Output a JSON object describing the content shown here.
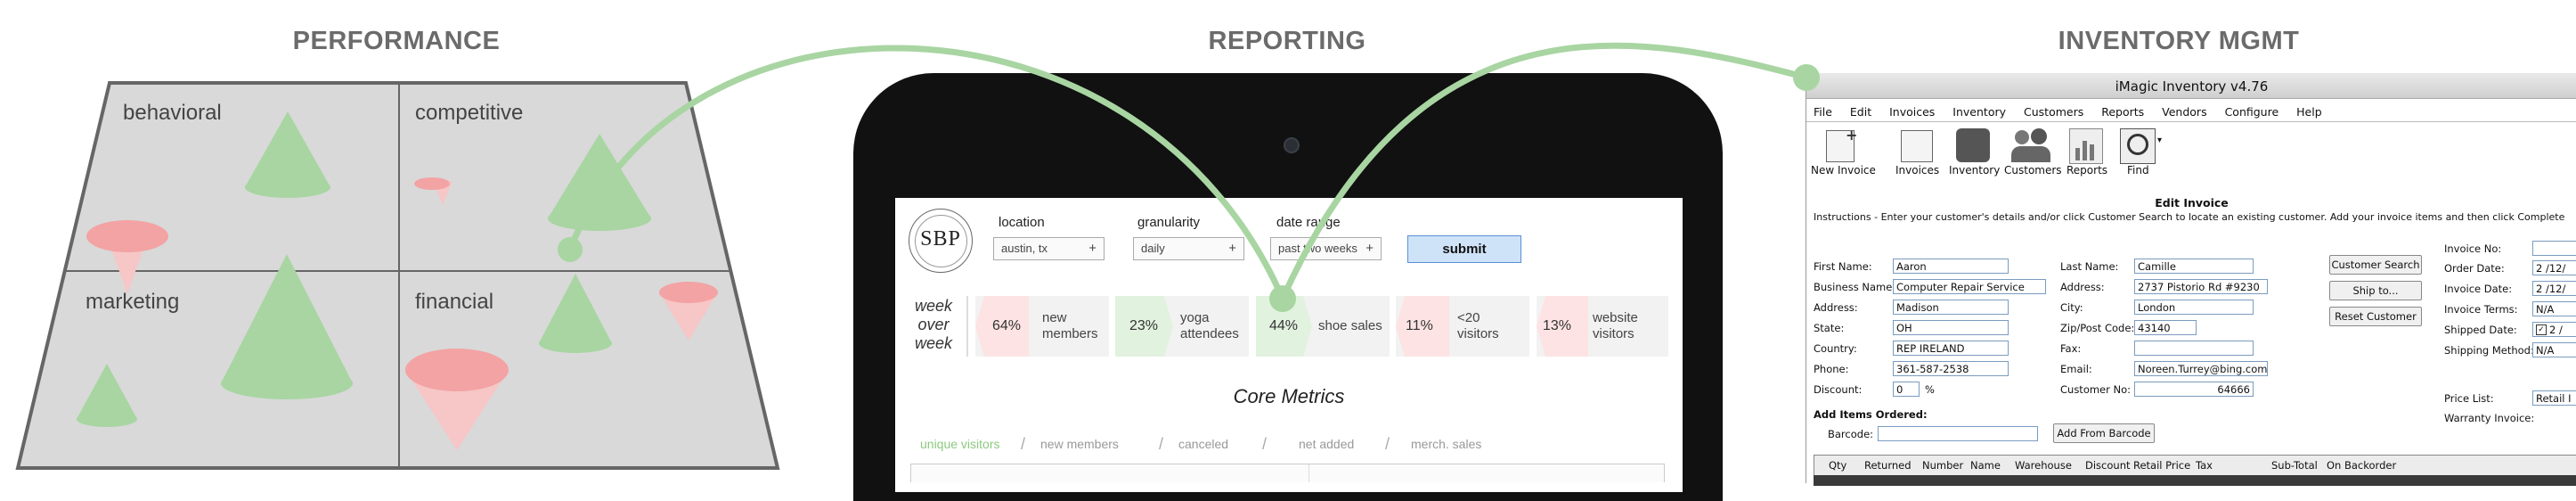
{
  "titles": {
    "performance": "PERFORMANCE",
    "reporting": "REPORTING",
    "inventory": "INVENTORY MGMT"
  },
  "performance": {
    "quadrants": [
      "behavioral",
      "competitive",
      "marketing",
      "financial"
    ],
    "colors": {
      "green": "#a8d5a2",
      "red": "#f3a3a3",
      "bg": "#d9d9d9"
    }
  },
  "reporting": {
    "logo_letters": "SBP",
    "logo_ring": "SEATTLE BOULDERING PROJECT",
    "filters": [
      {
        "label": "location",
        "value": "austin, tx"
      },
      {
        "label": "granularity",
        "value": "daily"
      },
      {
        "label": "date range",
        "value": "past two weeks"
      }
    ],
    "submit_label": "submit",
    "wow_label": [
      "week",
      "over",
      "week"
    ],
    "kpis": [
      {
        "value": "64%",
        "label": [
          "new",
          "members"
        ],
        "trend": "down"
      },
      {
        "value": "23%",
        "label": [
          "yoga",
          "attendees"
        ],
        "trend": "up"
      },
      {
        "value": "44%",
        "label": [
          "shoe sales"
        ],
        "trend": "up"
      },
      {
        "value": "11%",
        "label": [
          "<20",
          "visitors"
        ],
        "trend": "down"
      },
      {
        "value": "13%",
        "label": [
          "website",
          "visitors"
        ],
        "trend": "down"
      }
    ],
    "section_title": "Core Metrics",
    "tabs": [
      "unique visitors",
      "new members",
      "canceled",
      "net added",
      "merch. sales"
    ],
    "tab_colors": {
      "active": "#8cc97f",
      "inactive": "#999999"
    }
  },
  "inventory": {
    "window_title": "iMagic Inventory v4.76",
    "menu": [
      "File",
      "Edit",
      "Invoices",
      "Inventory",
      "Customers",
      "Reports",
      "Vendors",
      "Configure",
      "Help"
    ],
    "toolbar": [
      "New Invoice",
      "Invoices",
      "Inventory",
      "Customers",
      "Reports",
      "Find"
    ],
    "section_title": "Edit Invoice",
    "instructions": "Instructions - Enter your customer's details and/or click Customer Search to locate an existing customer. Add your invoice items and then click Complete",
    "left_fields": [
      {
        "label": "First Name:",
        "value": "Aaron"
      },
      {
        "label": "Business Name:",
        "value": "Computer Repair Service"
      },
      {
        "label": "Address:",
        "value": "Madison"
      },
      {
        "label": "State:",
        "value": "OH"
      },
      {
        "label": "Country:",
        "value": "REP IRELAND"
      },
      {
        "label": "Phone:",
        "value": "361-587-2538"
      },
      {
        "label": "Discount:",
        "value": "0"
      }
    ],
    "discount_unit": "%",
    "mid_fields": [
      {
        "label": "Last Name:",
        "value": "Camille"
      },
      {
        "label": "Address:",
        "value": "2737 Pistorio Rd #9230"
      },
      {
        "label": "City:",
        "value": "London"
      },
      {
        "label": "Zip/Post Code:",
        "value": "43140"
      },
      {
        "label": "Fax:",
        "value": ""
      },
      {
        "label": "Email:",
        "value": "Noreen.Turrey@bing.com"
      },
      {
        "label": "Customer No:",
        "value": "64666"
      }
    ],
    "buttons": [
      "Customer Search",
      "Ship to...",
      "Reset Customer"
    ],
    "right_fields": [
      {
        "label": "Invoice No:",
        "value": ""
      },
      {
        "label": "Order Date:",
        "value": "2 /12/"
      },
      {
        "label": "Invoice Date:",
        "value": "2 /12/"
      },
      {
        "label": "Invoice Terms:",
        "value": "N/A"
      },
      {
        "label": "Shipped Date:",
        "value": "2 /"
      },
      {
        "label": "Shipping Method:",
        "value": "N/A"
      }
    ],
    "price_list_label": "Price List:",
    "price_list_value": "Retail I",
    "warranty_label": "Warranty Invoice:",
    "add_items_label": "Add Items Ordered:",
    "barcode_label": "Barcode:",
    "add_barcode_button": "Add From Barcode",
    "grid_headers": [
      "Qty",
      "Returned",
      "Number",
      "Name",
      "Warehouse",
      "Discount",
      "Retail Price",
      "Tax",
      "Sub-Total",
      "On Backorder"
    ]
  }
}
